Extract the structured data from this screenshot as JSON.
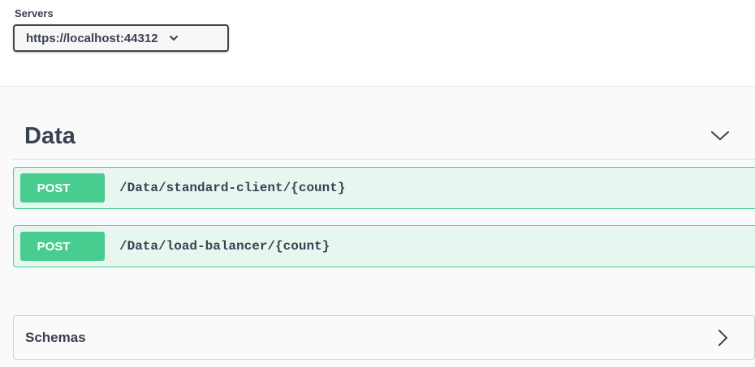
{
  "servers": {
    "label": "Servers",
    "selected": "https://localhost:44312"
  },
  "tag": {
    "title": "Data",
    "expanded": true
  },
  "operations": [
    {
      "method": "POST",
      "path": "/Data/standard-client/{count}"
    },
    {
      "method": "POST",
      "path": "/Data/load-balancer/{count}"
    }
  ],
  "schemas": {
    "title": "Schemas",
    "expanded": false
  },
  "colors": {
    "post_accent": "#49cc90",
    "post_background": "#e8f6f0",
    "text": "#3b4151"
  },
  "icons": {
    "server_dropdown": "chevron-down-icon",
    "tag_toggle": "chevron-down-icon",
    "schemas_toggle": "chevron-right-icon"
  }
}
